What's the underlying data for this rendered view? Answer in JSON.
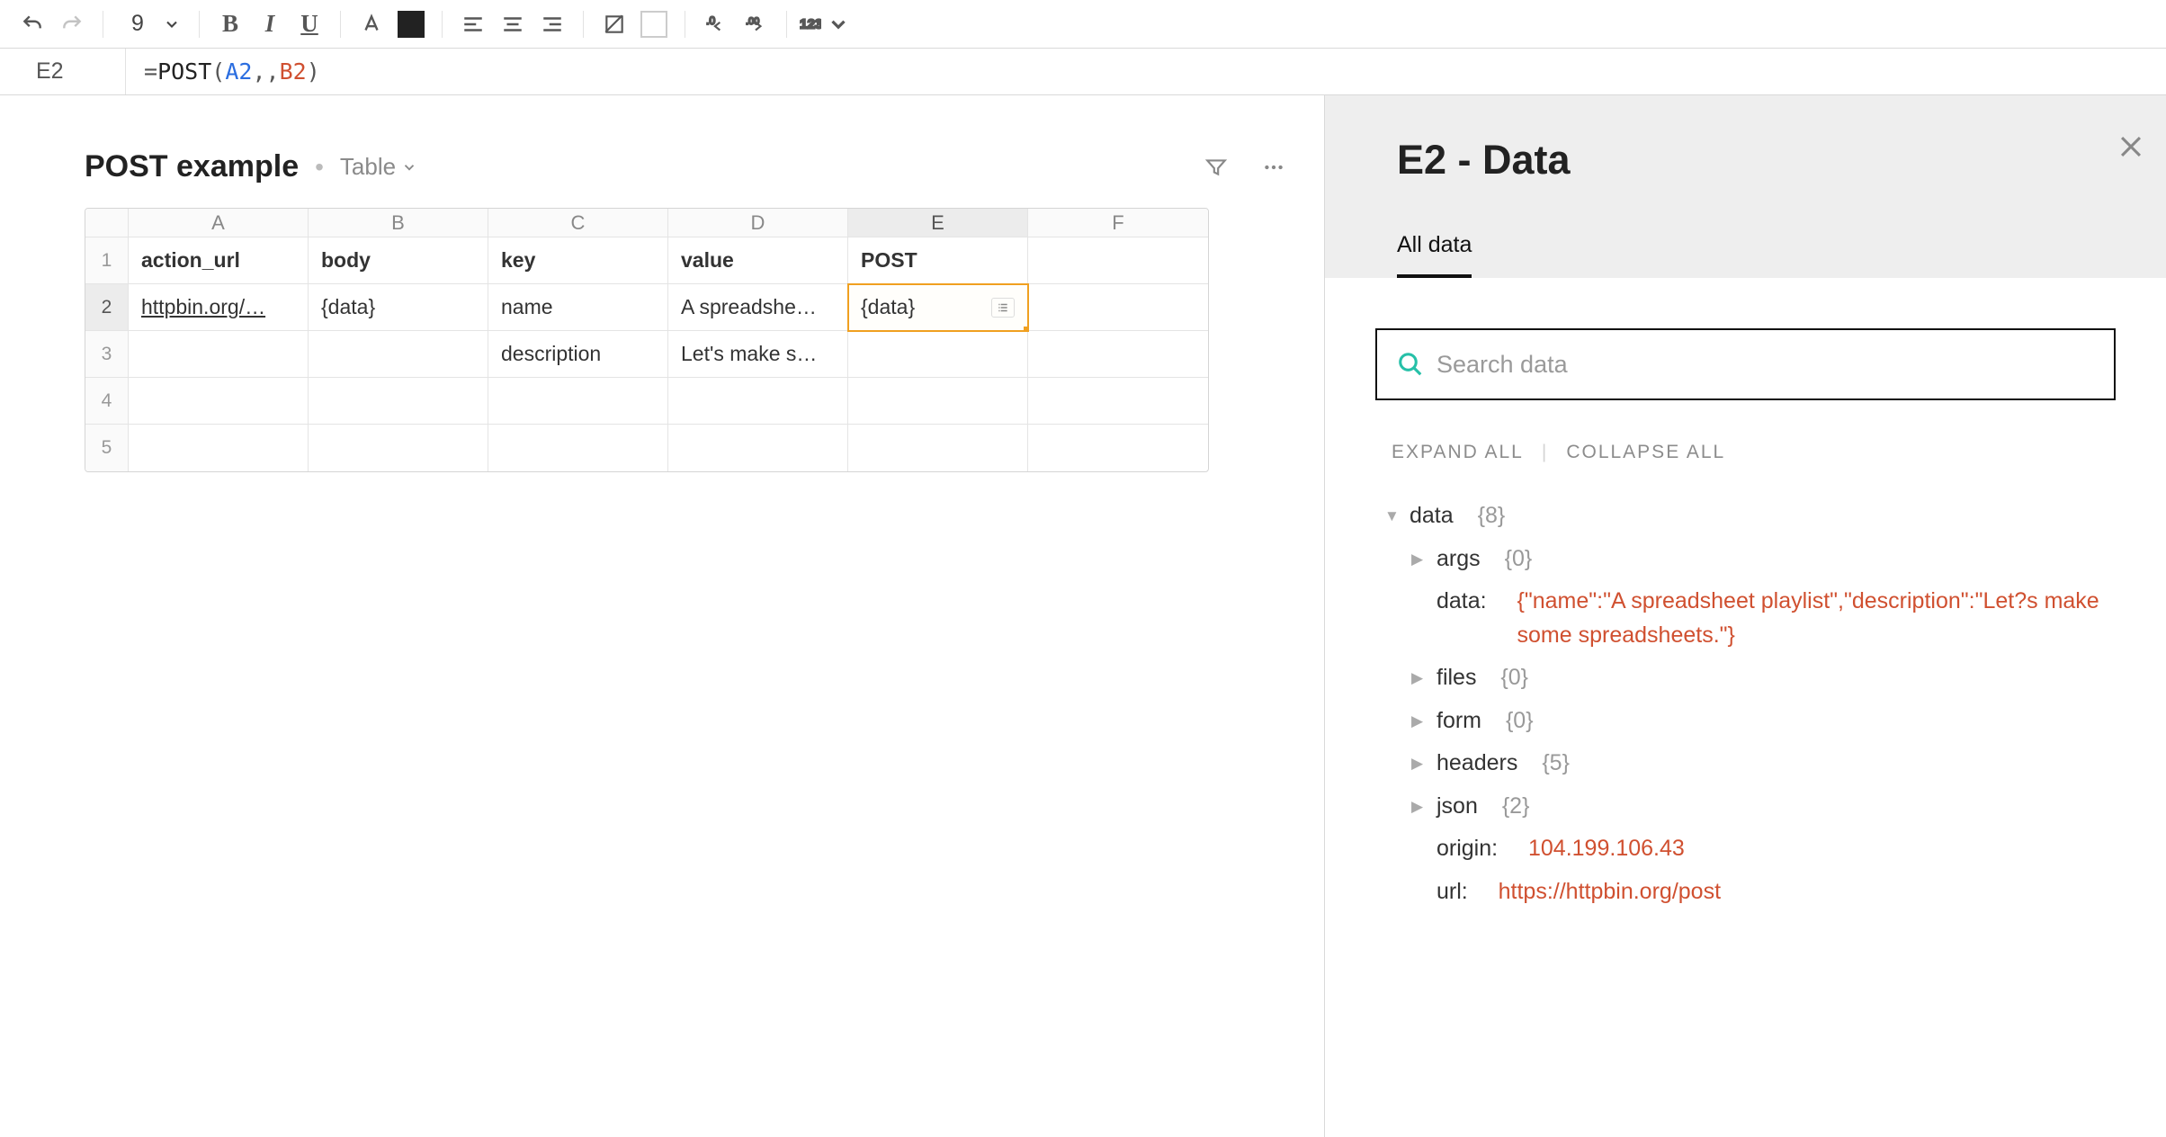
{
  "toolbar": {
    "fontsize": "9"
  },
  "formula": {
    "cell": "E2",
    "prefix": "=",
    "fn": "POST",
    "open": "(",
    "arg1": "A2",
    "comma1": ",",
    "comma2": ",",
    "arg2": "B2",
    "close": ")"
  },
  "sheet": {
    "title": "POST example",
    "view": "Table",
    "columns": [
      "A",
      "B",
      "C",
      "D",
      "E",
      "F"
    ],
    "header": {
      "A": "action_url",
      "B": "body",
      "C": "key",
      "D": "value",
      "E": "POST"
    },
    "rows": [
      {
        "n": "2",
        "A": "httpbin.org/…",
        "B": "{data}",
        "C": "name",
        "D": "A spreadshe…",
        "E": "{data}"
      },
      {
        "n": "3",
        "A": "",
        "B": "",
        "C": "description",
        "D": "Let's make s…",
        "E": ""
      },
      {
        "n": "4"
      },
      {
        "n": "5"
      }
    ]
  },
  "panel": {
    "title": "E2 - Data",
    "tab": "All data",
    "search_placeholder": "Search data",
    "expand": "EXPAND ALL",
    "collapse": "COLLAPSE ALL",
    "tree": {
      "root": "data",
      "root_count": "{8}",
      "args": "args",
      "args_count": "{0}",
      "data_key": "data:",
      "data_val": "{\"name\":\"A spreadsheet playlist\",\"description\":\"Let?s make some spreadsheets.\"}",
      "files": "files",
      "files_count": "{0}",
      "form": "form",
      "form_count": "{0}",
      "headers": "headers",
      "headers_count": "{5}",
      "json": "json",
      "json_count": "{2}",
      "origin_key": "origin:",
      "origin_val": "104.199.106.43",
      "url_key": "url:",
      "url_val": "https://httpbin.org/post"
    }
  }
}
